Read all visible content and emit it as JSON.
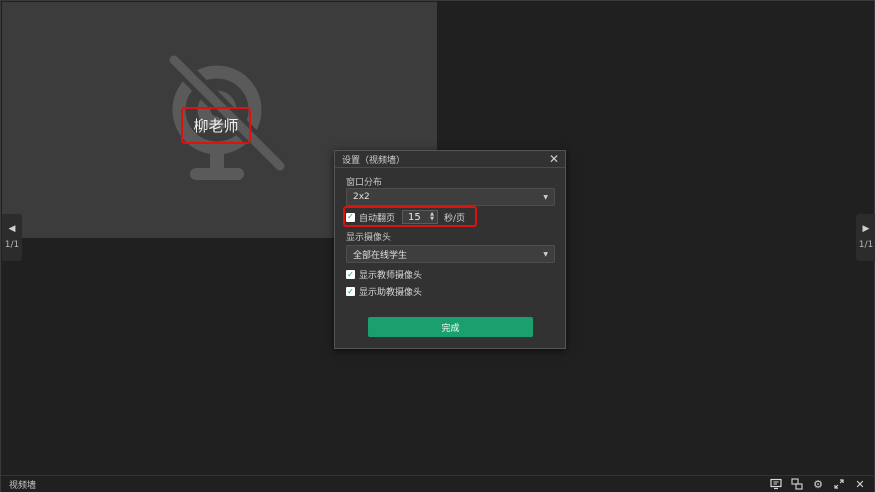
{
  "video_tile": {
    "teacher_name": "柳老师",
    "camera_state_icon": "camera-off-icon"
  },
  "page_nav": {
    "left_count": "1/1",
    "right_count": "1/1"
  },
  "dialog": {
    "title": "设置（视频墙）",
    "layout_label": "窗口分布",
    "layout_value": "2x2",
    "auto_flip_label": "自动翻页",
    "auto_flip_checked": true,
    "auto_flip_seconds": "15",
    "auto_flip_unit": "秒/页",
    "camera_label": "显示摄像头",
    "camera_value": "全部在线学生",
    "show_teacher_camera": "显示教师摄像头",
    "show_assistant_camera": "显示助教摄像头",
    "done_label": "完成"
  },
  "bottom_bar": {
    "title": "视频墙",
    "icons": [
      "screen-share-icon",
      "switch-icon",
      "settings-gear-icon",
      "expand-icon",
      "close-icon"
    ]
  },
  "colors": {
    "accent": "#1aa06d",
    "highlight": "#e01010"
  }
}
